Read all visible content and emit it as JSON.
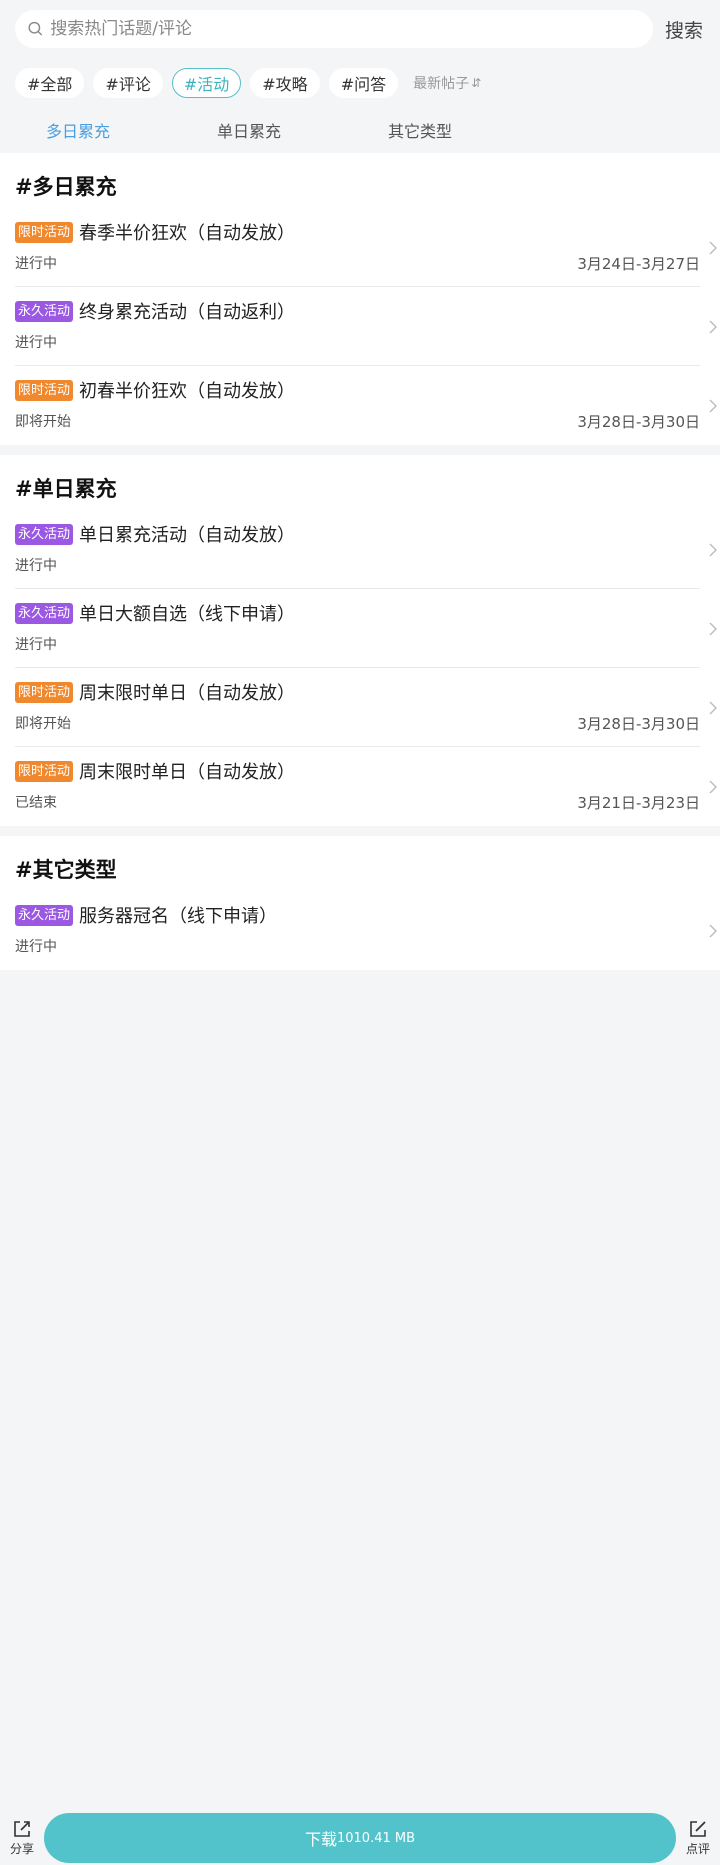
{
  "search": {
    "placeholder": "搜索热门话题/评论",
    "button": "搜索"
  },
  "tags": [
    {
      "label": "#全部",
      "active": false
    },
    {
      "label": "#评论",
      "active": false
    },
    {
      "label": "#活动",
      "active": true
    },
    {
      "label": "#攻略",
      "active": false
    },
    {
      "label": "#问答",
      "active": false
    }
  ],
  "sort_label": "最新帖子",
  "sort_icon": "⇵",
  "subtabs": [
    "多日累充",
    "单日累充",
    "其它类型"
  ],
  "sections": [
    {
      "title": "#多日累充",
      "items": [
        {
          "badge": "限时活动",
          "badge_type": "limited",
          "title": "春季半价狂欢（自动发放）",
          "status": "进行中",
          "dates": "3月24日-3月27日"
        },
        {
          "badge": "永久活动",
          "badge_type": "perm",
          "title": "终身累充活动（自动返利）",
          "status": "进行中",
          "dates": ""
        },
        {
          "badge": "限时活动",
          "badge_type": "limited",
          "title": "初春半价狂欢（自动发放）",
          "status": "即将开始",
          "dates": "3月28日-3月30日"
        }
      ]
    },
    {
      "title": "#单日累充",
      "items": [
        {
          "badge": "永久活动",
          "badge_type": "perm",
          "title": "单日累充活动（自动发放）",
          "status": "进行中",
          "dates": ""
        },
        {
          "badge": "永久活动",
          "badge_type": "perm",
          "title": "单日大额自选（线下申请）",
          "status": "进行中",
          "dates": ""
        },
        {
          "badge": "限时活动",
          "badge_type": "limited",
          "title": "周末限时单日（自动发放）",
          "status": "即将开始",
          "dates": "3月28日-3月30日"
        },
        {
          "badge": "限时活动",
          "badge_type": "limited",
          "title": "周末限时单日（自动发放）",
          "status": "已结束",
          "dates": "3月21日-3月23日"
        }
      ]
    },
    {
      "title": "#其它类型",
      "items": [
        {
          "badge": "永久活动",
          "badge_type": "perm",
          "title": "服务器冠名（线下申请）",
          "status": "进行中",
          "dates": ""
        }
      ]
    }
  ],
  "bottom": {
    "share": "分享",
    "review": "点评",
    "download_label": "下载",
    "download_size": "1010.41 MB"
  },
  "colors": {
    "accent": "#52c3cb",
    "limited": "#f0892e",
    "perm": "#9b59e3",
    "tab_active": "#4b9fe0"
  }
}
